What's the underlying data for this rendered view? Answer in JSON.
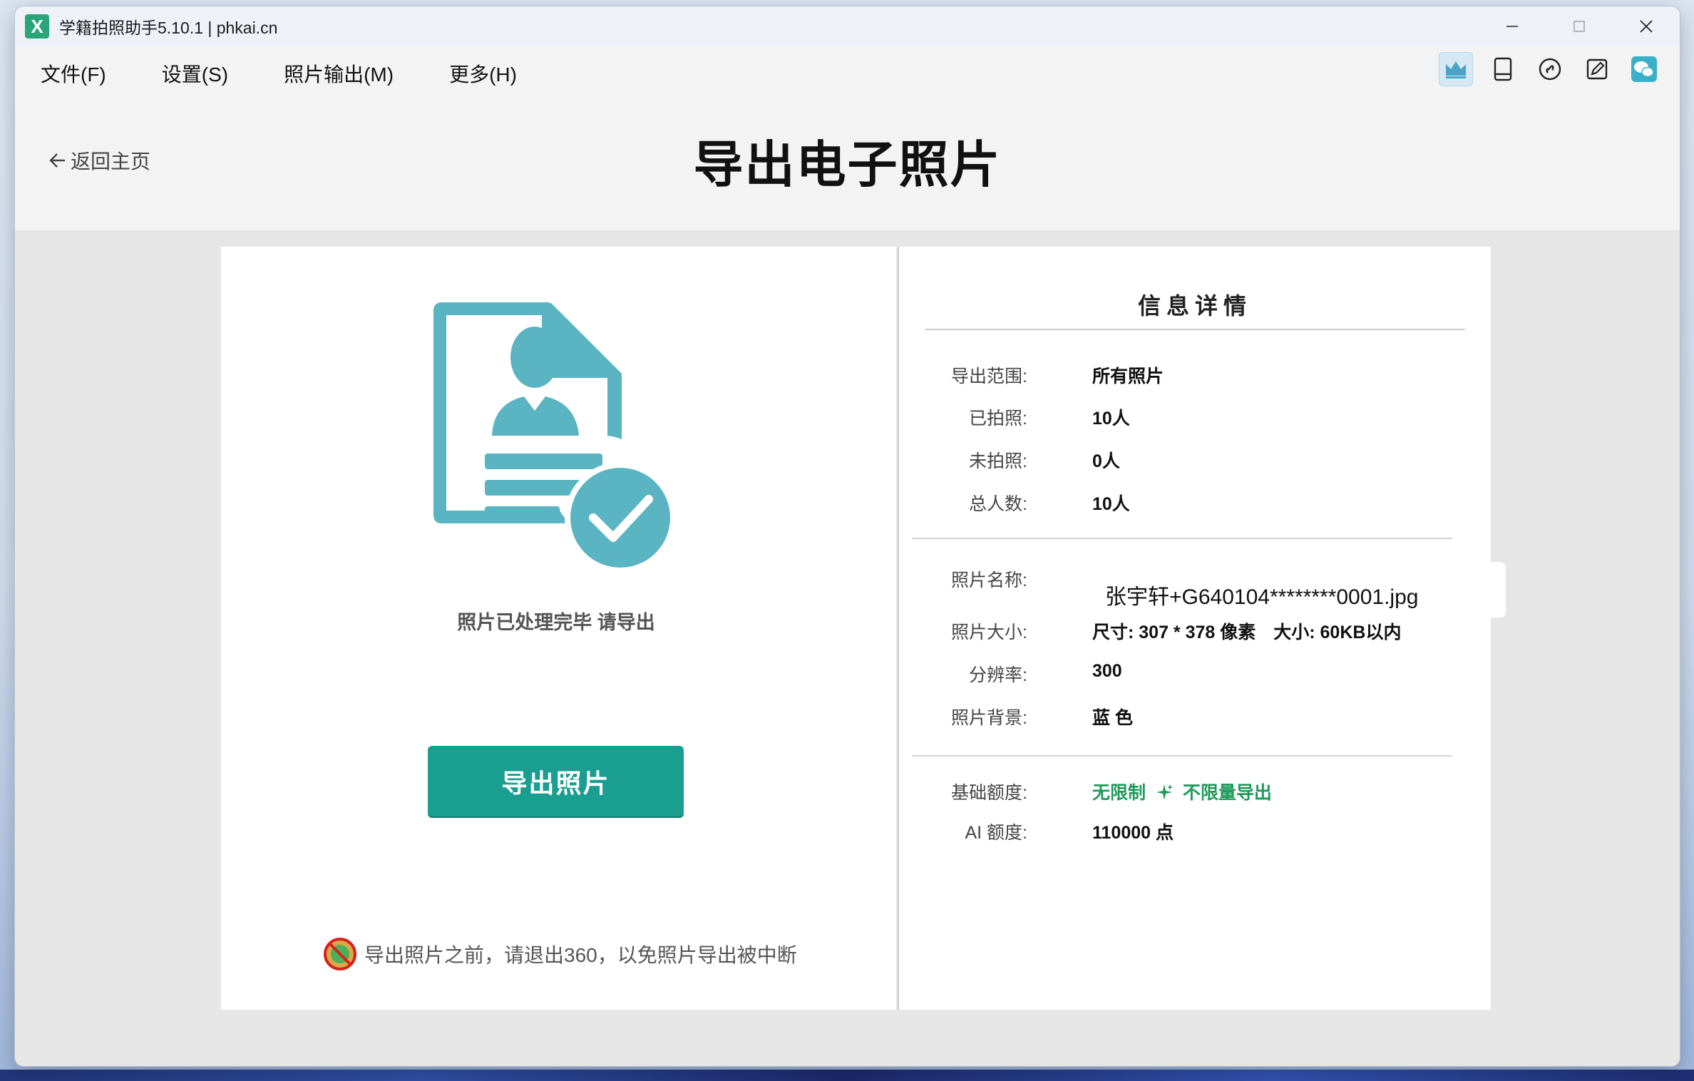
{
  "window": {
    "title": "学籍拍照助手5.10.1 | phkai.cn",
    "app_icon_letter": "X"
  },
  "menu": {
    "items": [
      "文件(F)",
      "设置(S)",
      "照片输出(M)",
      "更多(H)"
    ]
  },
  "toolbar": {
    "icons": [
      "crown-icon",
      "tablet-icon",
      "link-icon",
      "edit-icon",
      "wechat-icon"
    ]
  },
  "header": {
    "back_label": "返回主页",
    "title": "导出电子照片"
  },
  "left": {
    "status_text": "照片已处理完毕 请导出",
    "export_button": "导出照片",
    "warning_text": "导出照片之前，请退出360，以免照片导出被中断"
  },
  "details": {
    "title": "信息详情",
    "export_range_label": "导出范围:",
    "export_range_value": "所有照片",
    "taken_label": "已拍照:",
    "taken_value": "10人",
    "not_taken_label": "未拍照:",
    "not_taken_value": "0人",
    "total_label": "总人数:",
    "total_value": "10人",
    "photo_name_label": "照片名称:",
    "photo_name_value": "张宇轩+G640104********0001.jpg",
    "photo_size_label": "照片大小:",
    "photo_size_value": "尺寸: 307 * 378 像素　大小: 60KB以内",
    "resolution_label": "分辨率:",
    "resolution_value": "300",
    "background_label": "照片背景:",
    "background_value": "蓝 色",
    "quota_label": "基础额度:",
    "quota_value_a": "无限制",
    "quota_value_b": "不限量导出",
    "ai_quota_label": "AI 额度:",
    "ai_quota_value": "110000 点"
  },
  "colors": {
    "accent": "#199e90",
    "illustration": "#5ab4c2",
    "quota_green": "#1e9a5a"
  }
}
